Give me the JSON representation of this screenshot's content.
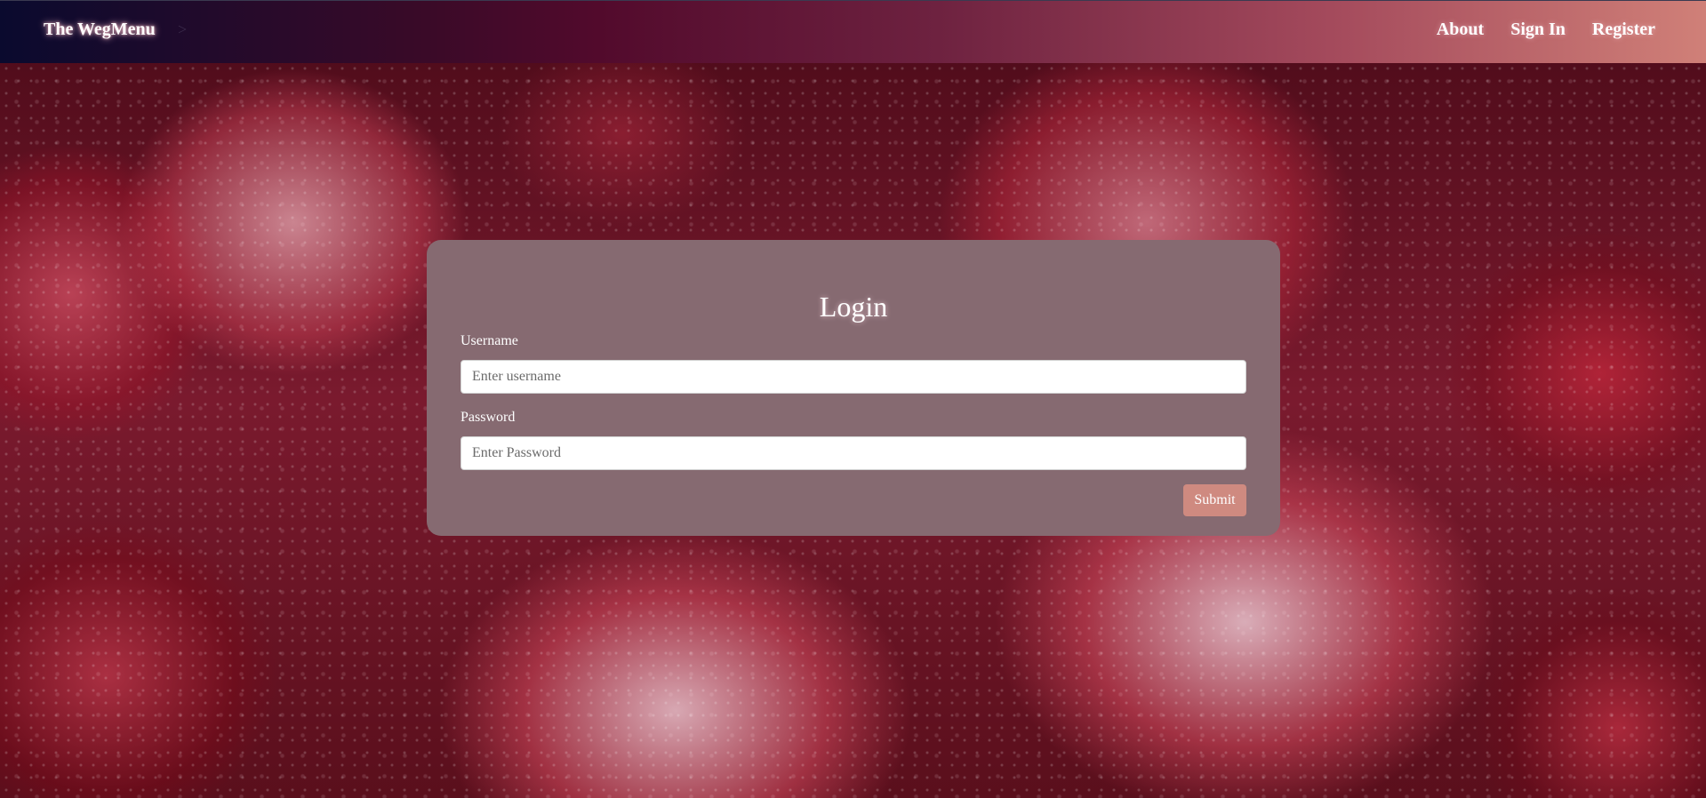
{
  "navbar": {
    "brand": "The WegMenu",
    "separator": ">",
    "links": [
      {
        "label": "About"
      },
      {
        "label": "Sign In"
      },
      {
        "label": "Register"
      }
    ]
  },
  "login": {
    "title": "Login",
    "username_label": "Username",
    "username_placeholder": "Enter username",
    "password_label": "Password",
    "password_placeholder": "Enter Password",
    "submit_label": "Submit"
  },
  "background": {
    "description_icon": "frosted-raspberries-image"
  },
  "colors": {
    "card_bg": "#866a71",
    "submit_bg": "#cf8a80",
    "nav_gradient_start": "#0a0a2e",
    "nav_gradient_end": "#d08078"
  }
}
